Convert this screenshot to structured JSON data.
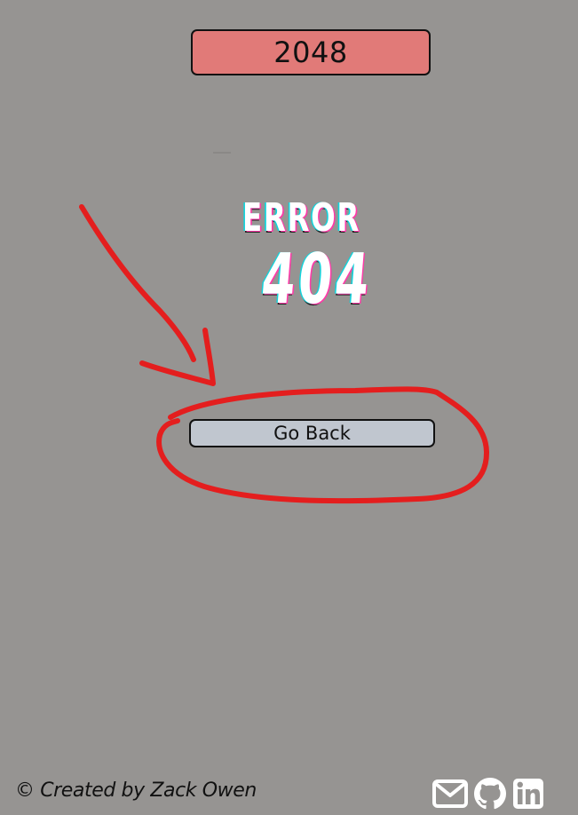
{
  "header": {
    "title": "2048"
  },
  "error": {
    "word": "ERROR",
    "code": "404"
  },
  "actions": {
    "go_back_label": "Go Back"
  },
  "footer": {
    "credit": "© Created by Zack Owen",
    "links": [
      {
        "icon": "mail-icon"
      },
      {
        "icon": "github-icon"
      },
      {
        "icon": "linkedin-icon"
      }
    ]
  },
  "colors": {
    "background": "#969492",
    "title_badge": "#e17a78",
    "button": "#c0c6cf",
    "annotation": "#e41e1e",
    "glitch_cyan": "#12d4dc",
    "glitch_magenta": "#ff3aa8"
  }
}
